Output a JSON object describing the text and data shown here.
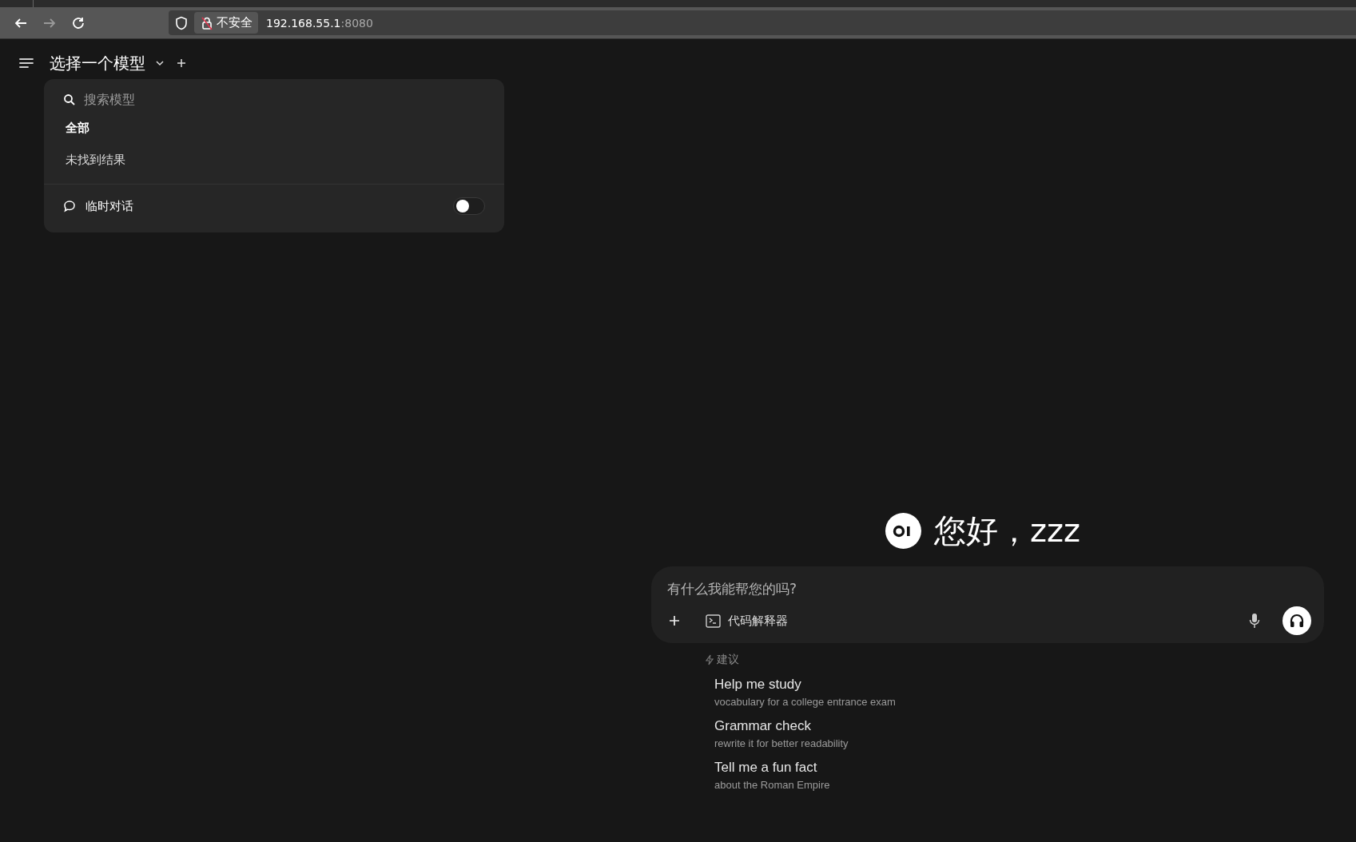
{
  "browser": {
    "forward_disabled": true,
    "security_label": "不安全",
    "url_host": "192.168.55.1",
    "url_port": ":8080"
  },
  "header": {
    "title": "选择一个模型"
  },
  "model_menu": {
    "search": {
      "placeholder": "搜索模型"
    },
    "filter_tabs": [
      {
        "label": "全部",
        "selected": true
      }
    ],
    "empty_message": "未找到结果",
    "temporary_chat": {
      "label": "临时对话",
      "on": false
    }
  },
  "greeting": "您好，zzz",
  "composer": {
    "placeholder": "有什么我能帮您的吗?",
    "tools": [
      {
        "label": "代码解释器"
      }
    ]
  },
  "suggestions": {
    "label": "建议",
    "items": [
      {
        "title": "Help me study",
        "subtitle": "vocabulary for a college entrance exam"
      },
      {
        "title": "Grammar check",
        "subtitle": "rewrite it for better readability"
      },
      {
        "title": "Tell me a fun fact",
        "subtitle": "about the Roman Empire"
      }
    ]
  }
}
